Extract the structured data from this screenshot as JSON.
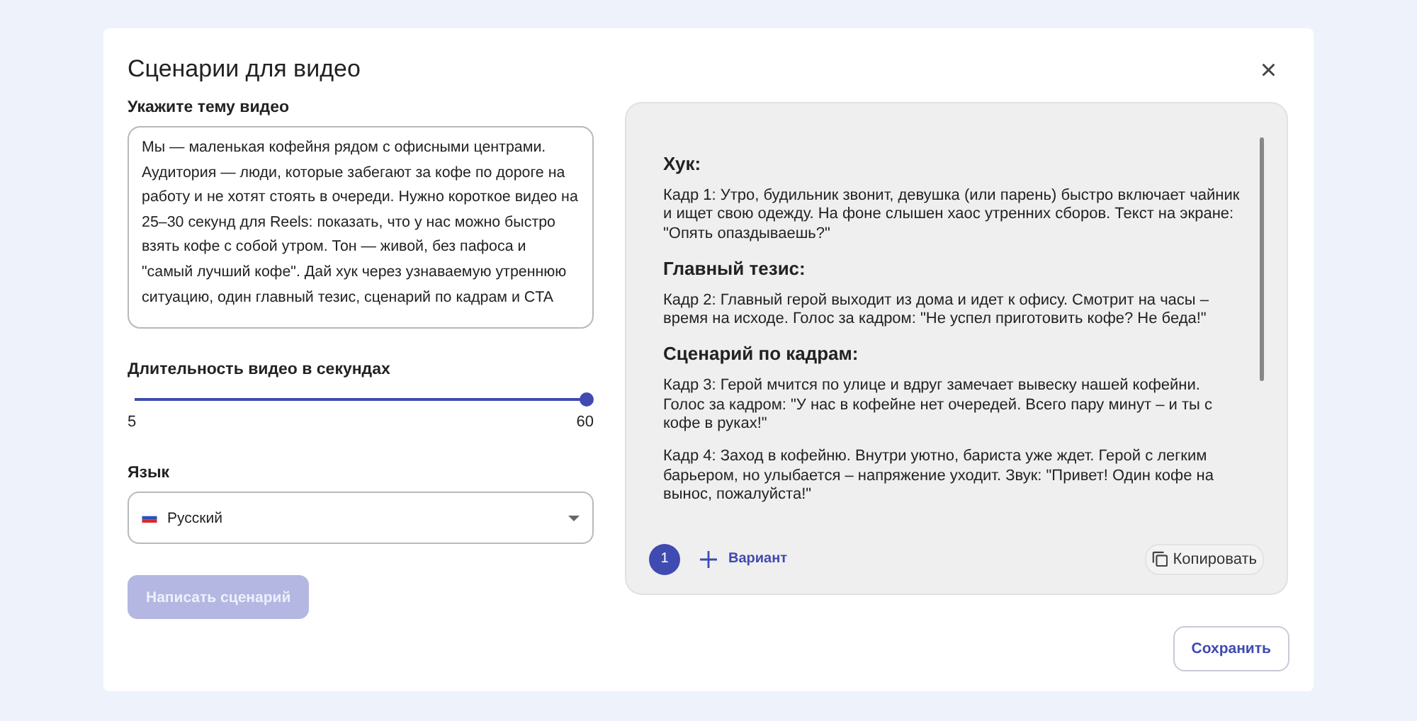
{
  "dialog": {
    "title": "Сценарии для видео",
    "close": "×"
  },
  "topic": {
    "label": "Укажите тему видео",
    "value": "Мы — маленькая кофейня рядом с офисными центрами. Аудитория — люди, которые забегают за кофе по дороге на работу и не хотят стоять в очереди. Нужно короткое видео на 25–30 секунд для Reels: показать, что у нас можно быстро взять кофе с собой утром. Тон — живой, без пафоса и \"самый лучший кофе\". Дай хук через узнаваемую утреннюю ситуацию, один главный тезис, сценарий по кадрам и CTA"
  },
  "duration": {
    "label": "Длительность видео в секундах",
    "level": 1,
    "min": "5",
    "max": "60"
  },
  "language": {
    "label": "Язык",
    "value": "Русский"
  },
  "generate_button": {
    "label": "Написать сценарий",
    "disabled": true
  },
  "script": [
    {
      "kind": "heading",
      "text": "Хук:"
    },
    {
      "kind": "paragraph",
      "text": "Кадр 1: Утро, будильник звонит, девушка (или парень) быстро включает чайник и ищет свою одежду. На фоне слышен хаос утренних сборов. Текст на экране: \"Опять опаздываешь?\""
    },
    {
      "kind": "heading",
      "text": "Главный тезис:"
    },
    {
      "kind": "paragraph",
      "text": "Кадр 2: Главный герой выходит из дома и идет к офису. Смотрит на часы – время на исходе. Голос за кадром: \"Не успел приготовить кофе? Не беда!\""
    },
    {
      "kind": "heading",
      "text": "Сценарий по кадрам:"
    },
    {
      "kind": "paragraph",
      "text": "Кадр 3: Герой мчится по улице и вдруг замечает вывеску нашей кофейни. Голос за кадром: \"У нас в кофейне нет очередей. Всего пару минут – и ты с кофе в руках!\""
    },
    {
      "kind": "paragraph",
      "text": "Кадр 4: Заход в кофейню. Внутри уютно, бариста уже ждет. Герой с легким барьером, но улыбается – напряжение уходит. Звук: \"Привет! Один кофе на вынос, пожалуйста!\""
    }
  ],
  "variants": [
    {
      "label": "1",
      "selected": true
    }
  ],
  "add_variant": "Вариант",
  "copy_button": "Копировать",
  "save_button": "Сохранить"
}
